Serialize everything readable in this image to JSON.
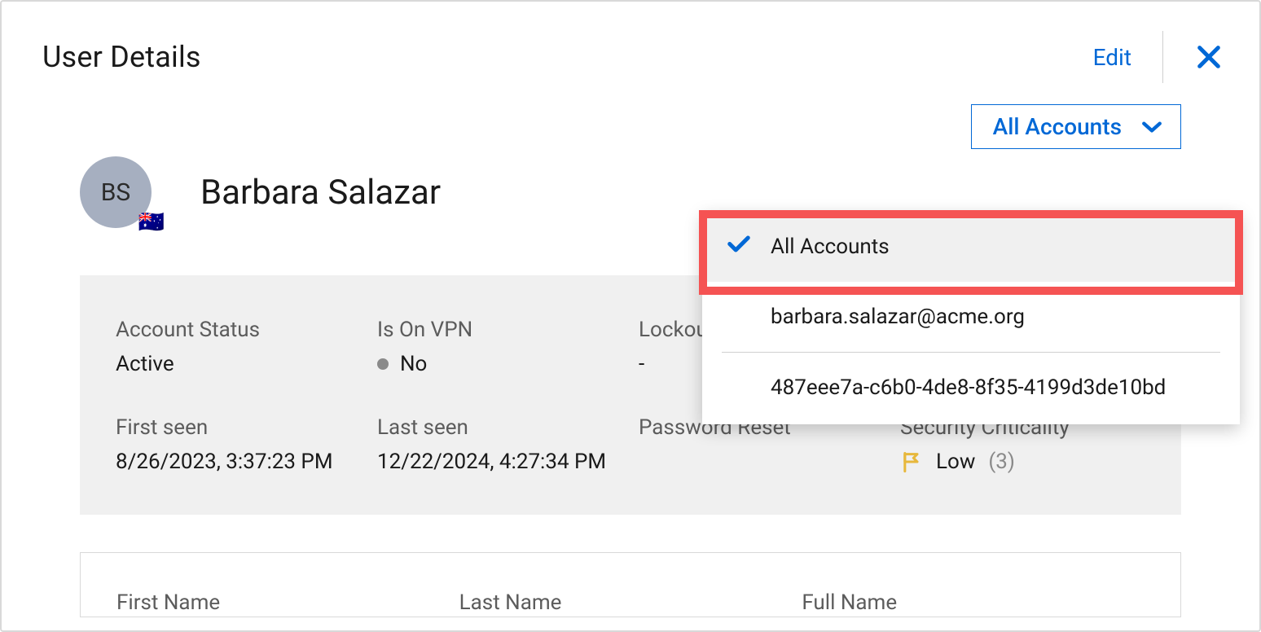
{
  "header": {
    "title": "User Details",
    "edit_label": "Edit"
  },
  "user": {
    "initials": "BS",
    "flag": "🇦🇺",
    "name": "Barbara Salazar"
  },
  "accounts_button": {
    "label": "All Accounts"
  },
  "dropdown": {
    "items": [
      {
        "label": "All Accounts",
        "selected": true
      },
      {
        "label": "barbara.salazar@acme.org",
        "selected": false
      },
      {
        "label": "487eee7a-c6b0-4de8-8f35-4199d3de10bd",
        "selected": false
      }
    ]
  },
  "summary": {
    "account_status": {
      "label": "Account Status",
      "value": "Active"
    },
    "is_on_vpn": {
      "label": "Is On VPN",
      "value": "No"
    },
    "lockout": {
      "label": "Lockout",
      "value": "-"
    },
    "first_seen": {
      "label": "First seen",
      "value": "8/26/2023, 3:37:23 PM"
    },
    "last_seen": {
      "label": "Last seen",
      "value": "12/22/2024, 4:27:34 PM"
    },
    "password_reset": {
      "label": "Password Reset",
      "value": ""
    },
    "security_criticality": {
      "label": "Security Criticality",
      "level": "Low",
      "count": "(3)"
    }
  },
  "lower": {
    "first_name_label": "First Name",
    "last_name_label": "Last Name",
    "full_name_label": "Full Name"
  }
}
